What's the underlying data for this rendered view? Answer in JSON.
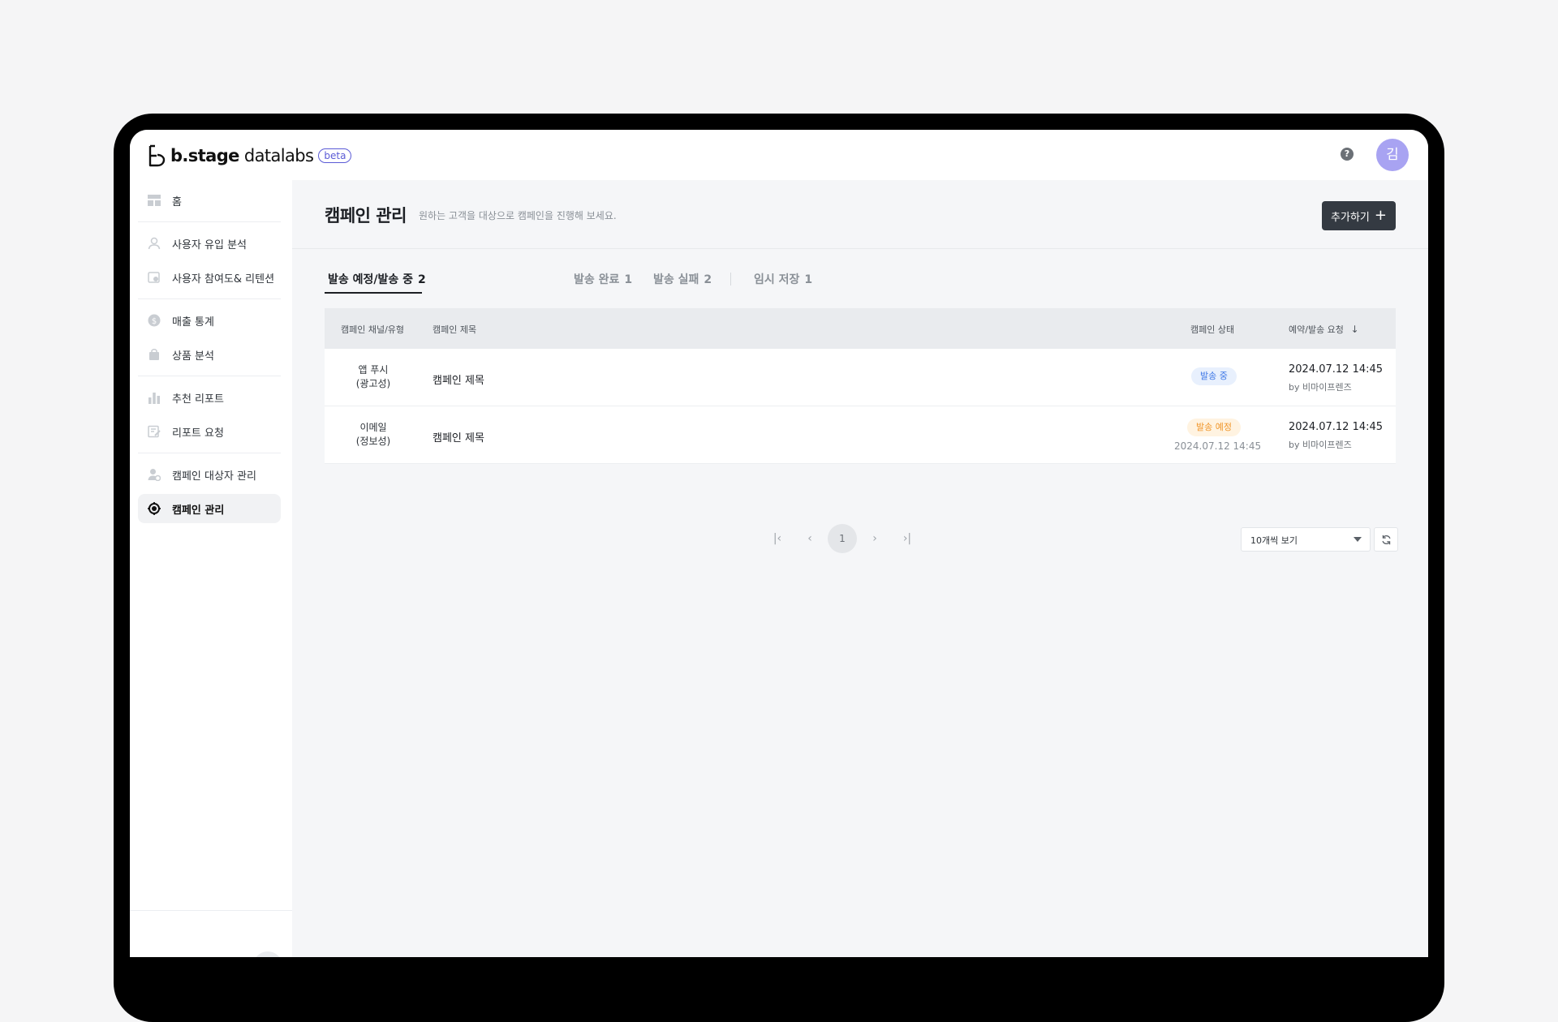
{
  "app": {
    "logo_brand": "b.stage",
    "logo_product": "datalabs",
    "beta_label": "beta",
    "help_icon": "?",
    "avatar_initial": "김"
  },
  "sidebar": {
    "items": [
      {
        "label": "홈",
        "icon": "dashboard-icon"
      },
      {
        "label": "사용자 유입 분석",
        "icon": "user-icon"
      },
      {
        "label": "사용자 참여도& 리텐션",
        "icon": "engagement-icon"
      },
      {
        "label": "매출 통계",
        "icon": "dollar-icon"
      },
      {
        "label": "상품 분석",
        "icon": "shopping-bag-icon"
      },
      {
        "label": "추천 리포트",
        "icon": "bar-chart-icon"
      },
      {
        "label": "리포트 요청",
        "icon": "edit-report-icon"
      },
      {
        "label": "캠페인 대상자 관리",
        "icon": "user-check-icon"
      },
      {
        "label": "캠페인 관리",
        "icon": "target-icon",
        "active": true
      }
    ],
    "collapse_icon": "‹"
  },
  "page": {
    "title": "캠페인 관리",
    "description": "원하는 고객을 대상으로 캠페인을 진행해 보세요.",
    "add_button": "추가하기",
    "add_icon": "+"
  },
  "tabs": [
    {
      "label": "발송 예정/발송 중",
      "count": "2",
      "active": true
    },
    {
      "label": "발송 완료",
      "count": "1"
    },
    {
      "label": "발송 실패",
      "count": "2"
    },
    {
      "label": "임시 저장",
      "count": "1"
    }
  ],
  "table": {
    "headers": {
      "channel": "캠페인 채널/유형",
      "title": "캠페인 제목",
      "status": "캠페인 상태",
      "date": "예약/발송 요청"
    },
    "sort_icon": "↓",
    "rows": [
      {
        "channel_line1": "앱 푸시",
        "channel_line2": "(광고성)",
        "title": "캠페인 제목",
        "status": "발송 중",
        "status_color": "#3e78e6",
        "status_sub": "",
        "date": "2024.07.12 14:45",
        "by": "by 비마이프렌즈"
      },
      {
        "channel_line1": "이메일",
        "channel_line2": "(정보성)",
        "title": "캠페인 제목",
        "status": "발송 예정",
        "status_color": "#f0962a",
        "status_sub": "2024.07.12 14:45",
        "date": "2024.07.12 14:45",
        "by": "by 비마이프렌즈"
      }
    ]
  },
  "pagination": {
    "first": "|‹",
    "prev": "‹",
    "current": "1",
    "next": "›",
    "last": "›|",
    "page_size": "10개씩 보기"
  }
}
